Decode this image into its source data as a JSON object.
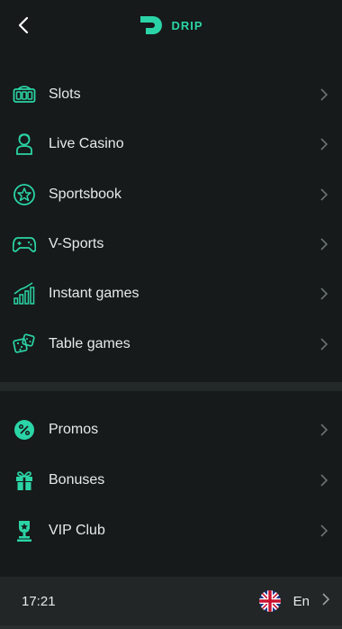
{
  "brand": {
    "name": "DRIP",
    "accent": "#2bd4a6"
  },
  "header": {
    "back_icon": "chevron-left-icon"
  },
  "menu": [
    {
      "label": "Slots",
      "icon": "slot-machine-icon"
    },
    {
      "label": "Live Casino",
      "icon": "live-dealer-icon"
    },
    {
      "label": "Sportsbook",
      "icon": "star-circle-icon"
    },
    {
      "label": "V-Sports",
      "icon": "gamepad-icon"
    },
    {
      "label": "Instant games",
      "icon": "rising-chart-icon"
    },
    {
      "label": "Table games",
      "icon": "dice-icon"
    }
  ],
  "promo_menu": [
    {
      "label": "Promos",
      "icon": "percent-icon"
    },
    {
      "label": "Bonuses",
      "icon": "gift-icon"
    },
    {
      "label": "VIP Club",
      "icon": "trophy-icon"
    }
  ],
  "footer": {
    "time": "17:21",
    "language": "En",
    "flag": "uk-flag-icon"
  }
}
